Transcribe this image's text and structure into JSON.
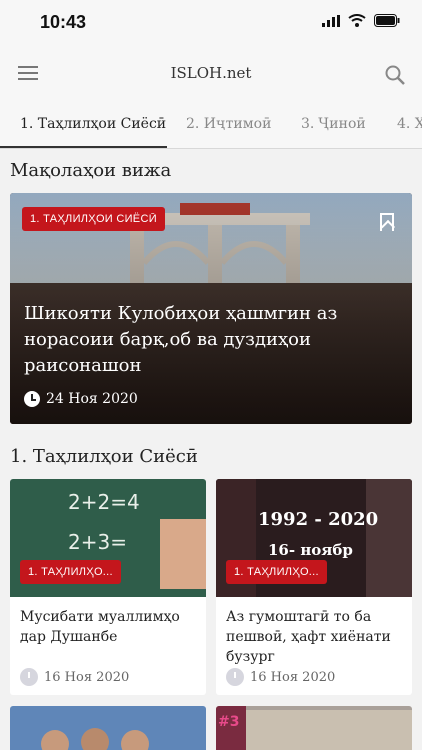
{
  "status": {
    "time": "10:43"
  },
  "app": {
    "title": "ISLOH.net"
  },
  "tabs": [
    {
      "label": "1. Таҳлилҳои Сиёсӣ"
    },
    {
      "label": "2. Иҷтимоӣ"
    },
    {
      "label": "3. Ҷиноӣ"
    },
    {
      "label": "4. Х"
    }
  ],
  "featured": {
    "section_title": "Мақолаҳои вижа",
    "tag": "1. ТАҲЛИЛҲОИ СИЁСӢ",
    "title": "Шикояти Кулобиҳои ҳашмгин аз норасоии барқ,об ва дуздиҳои раисонашон",
    "date": "24 Ноя 2020"
  },
  "section2": {
    "title": "1. Таҳлилҳои Сиёсӣ",
    "cards": [
      {
        "tag": "1. ТАҲЛИЛҲО...",
        "title": "Мусибати муаллимҳо дар Душанбе",
        "date": "16 Ноя 2020",
        "img_text": [
          "2+2=4",
          "2+3="
        ]
      },
      {
        "tag": "1. ТАҲЛИЛҲО...",
        "title": "Аз гумоштагӣ то ба пешвоӣ, ҳафт хиёнати бузург",
        "date": "16 Ноя 2020",
        "img_text": [
          "1992 - 2020",
          "16- ноябр"
        ]
      }
    ]
  },
  "colors": {
    "accent": "#c4161c",
    "background": "#f2f2f2"
  }
}
